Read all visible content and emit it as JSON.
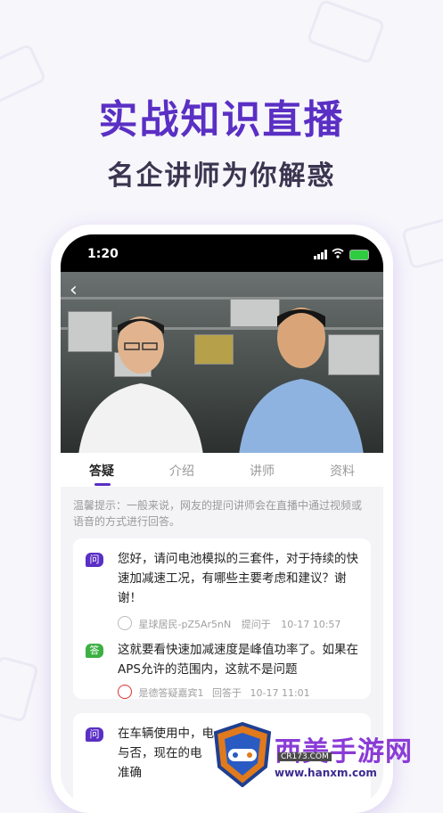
{
  "hero": {
    "title": "实战知识直播",
    "subtitle": "名企讲师为你解惑"
  },
  "status_bar": {
    "time": "1:20"
  },
  "tabs": [
    {
      "label": "答疑",
      "active": true
    },
    {
      "label": "介绍",
      "active": false
    },
    {
      "label": "讲师",
      "active": false
    },
    {
      "label": "资料",
      "active": false
    }
  ],
  "tip": "温馨提示：一般来说，网友的提问讲师会在直播中通过视频或语音的方式进行回答。",
  "qa": [
    {
      "q_badge": "问",
      "question": "您好，请问电池模拟的三套件，对于持续的快速加减速工况，有哪些主要考虑和建议？谢谢！",
      "asker": "星球居民-pZ5Ar5nN",
      "asked_label": "提问于",
      "asked_time": "10-17 10:57",
      "a_badge": "答",
      "answer": "这就要看快速加减速度是峰值功率了。如果在APS允许的范围内，这就不是问题",
      "answerer": "是德答疑嘉宾1",
      "answered_label": "回答于",
      "answered_time": "10-17 11:01"
    },
    {
      "q_badge": "问",
      "question": "在车辆使用中，电与否，现在的电 准确"
    }
  ],
  "watermark": {
    "text": "西美手游网",
    "url": "www.hanxm.com",
    "sub": "CR173.COM"
  },
  "colors": {
    "accent": "#5a2fc4",
    "answer_badge": "#3cb043"
  }
}
